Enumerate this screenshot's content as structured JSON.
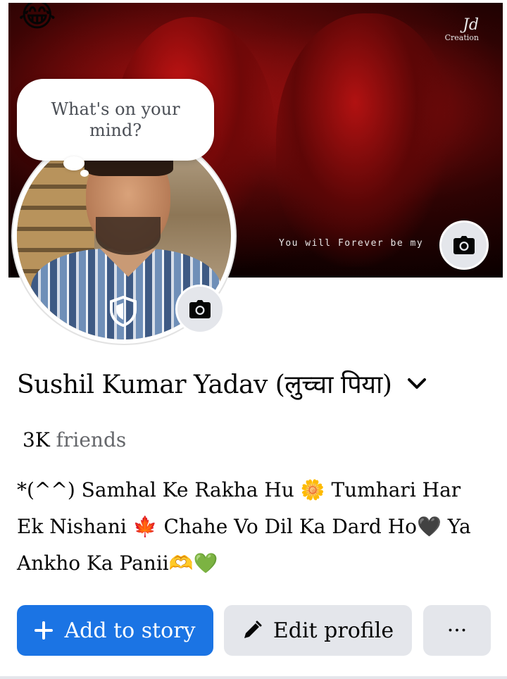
{
  "cover": {
    "corner_emoji": "😂",
    "watermark_sig": "Jd",
    "watermark_text": "Creation",
    "caption": "You will Forever be my",
    "camera_icon": "camera-icon"
  },
  "avatar": {
    "bubble_text": "What's on your mind?",
    "shield_icon": "shield-icon",
    "camera_icon": "camera-icon"
  },
  "profile": {
    "name": "Sushil Kumar Yadav (लुच्चा पिया)",
    "friends_count": "3K",
    "friends_label": "friends",
    "bio": "*(^^) Samhal Ke Rakha Hu 🌼 Tumhari Har Ek Nishani 🍁 Chahe Vo Dil Ka Dard Ho🖤 Ya Ankho Ka Panii🫶💚"
  },
  "actions": {
    "add_story_label": "Add to story",
    "edit_profile_label": "Edit profile",
    "more_label": "···"
  },
  "colors": {
    "primary": "#1b74e4",
    "secondary_bg": "#e4e6eb",
    "text_secondary": "#65676b"
  }
}
